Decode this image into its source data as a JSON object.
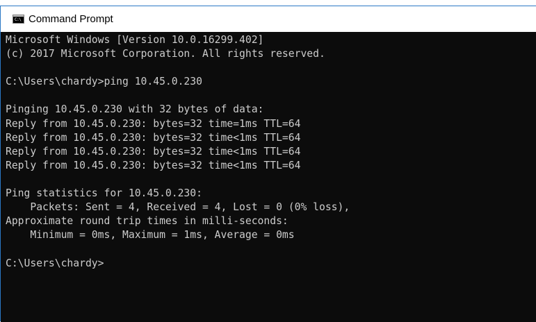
{
  "window": {
    "title": "Command Prompt",
    "icon": "command-prompt-icon",
    "icon_glyph": "C:\\"
  },
  "console": {
    "foreground": "#cccccc",
    "background": "#0c0c0c",
    "lines": [
      "Microsoft Windows [Version 10.0.16299.402]",
      "(c) 2017 Microsoft Corporation. All rights reserved.",
      "",
      "C:\\Users\\chardy>ping 10.45.0.230",
      "",
      "Pinging 10.45.0.230 with 32 bytes of data:",
      "Reply from 10.45.0.230: bytes=32 time=1ms TTL=64",
      "Reply from 10.45.0.230: bytes=32 time<1ms TTL=64",
      "Reply from 10.45.0.230: bytes=32 time<1ms TTL=64",
      "Reply from 10.45.0.230: bytes=32 time<1ms TTL=64",
      "",
      "Ping statistics for 10.45.0.230:",
      "    Packets: Sent = 4, Received = 4, Lost = 0 (0% loss),",
      "Approximate round trip times in milli-seconds:",
      "    Minimum = 0ms, Maximum = 1ms, Average = 0ms",
      "",
      "C:\\Users\\chardy>"
    ]
  }
}
